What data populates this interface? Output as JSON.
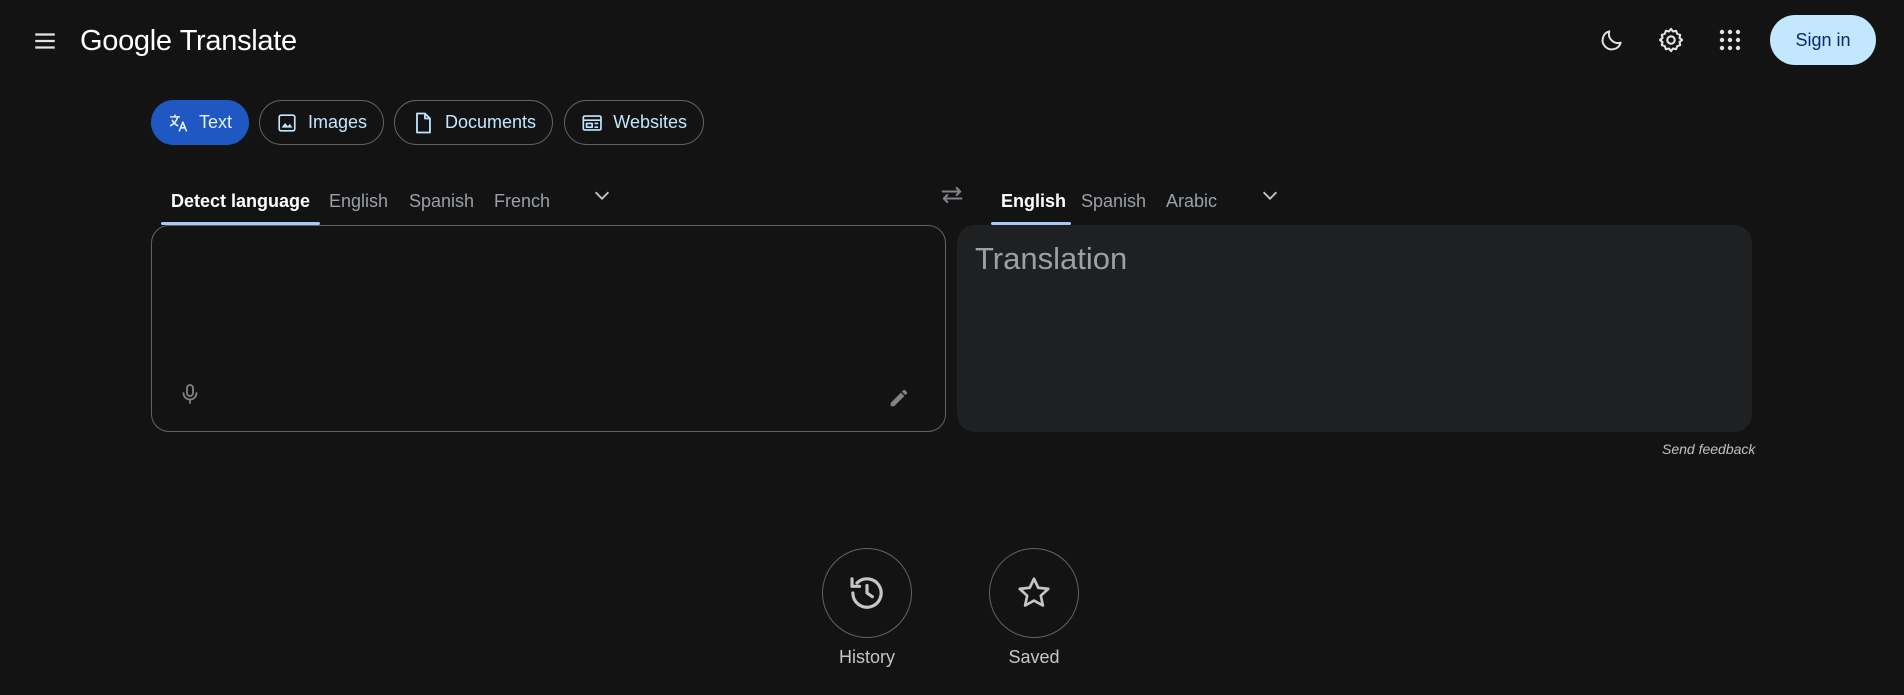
{
  "header": {
    "logo_google": "Google",
    "logo_product": "Translate",
    "sign_in_label": "Sign in"
  },
  "modes": [
    {
      "label": "Text",
      "icon": "translate-icon",
      "active": true
    },
    {
      "label": "Images",
      "icon": "image-icon",
      "active": false
    },
    {
      "label": "Documents",
      "icon": "document-icon",
      "active": false
    },
    {
      "label": "Websites",
      "icon": "website-icon",
      "active": false
    }
  ],
  "source_languages": [
    "Detect language",
    "English",
    "Spanish",
    "French"
  ],
  "target_languages": [
    "English",
    "Spanish",
    "Arabic"
  ],
  "source_input": {
    "value": ""
  },
  "target_output": {
    "placeholder": "Translation"
  },
  "send_feedback_label": "Send feedback",
  "bottom_actions": [
    {
      "label": "History",
      "icon": "history-icon"
    },
    {
      "label": "Saved",
      "icon": "star-icon"
    }
  ],
  "colors": {
    "background": "#131313",
    "accent_chip": "#1f57c3",
    "sign_in_bg": "#c2e7ff",
    "target_panel": "#1f2022",
    "underline": "#a8c7fa"
  }
}
